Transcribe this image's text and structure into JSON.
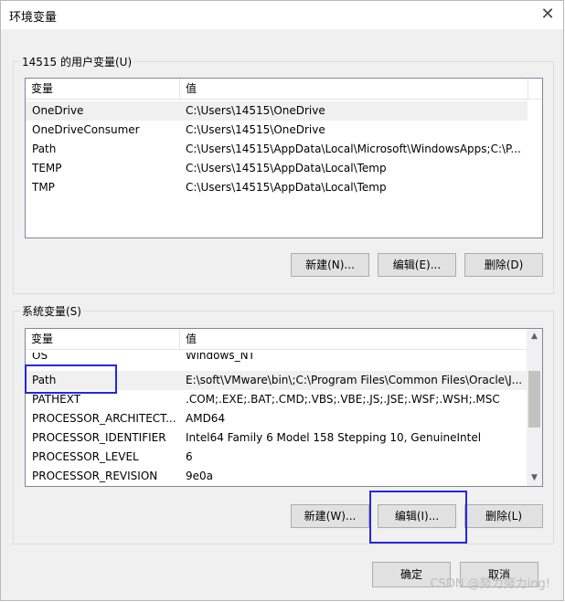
{
  "window": {
    "title": "环境变量",
    "close_glyph": "✕"
  },
  "user_vars": {
    "group_title": "14515 的用户变量(U)",
    "headers": [
      "变量",
      "值"
    ],
    "rows": [
      {
        "name": "OneDrive",
        "value": "C:\\Users\\14515\\OneDrive"
      },
      {
        "name": "OneDriveConsumer",
        "value": "C:\\Users\\14515\\OneDrive"
      },
      {
        "name": "Path",
        "value": "C:\\Users\\14515\\AppData\\Local\\Microsoft\\WindowsApps;C:\\P..."
      },
      {
        "name": "TEMP",
        "value": "C:\\Users\\14515\\AppData\\Local\\Temp"
      },
      {
        "name": "TMP",
        "value": "C:\\Users\\14515\\AppData\\Local\\Temp"
      }
    ],
    "buttons": {
      "new": "新建(N)...",
      "edit": "编辑(E)...",
      "delete": "删除(D)"
    }
  },
  "sys_vars": {
    "group_title": "系统变量(S)",
    "headers": [
      "变量",
      "值"
    ],
    "rows": [
      {
        "name": "OS",
        "value": "Windows_NT"
      },
      {
        "name": "Path",
        "value": "E:\\soft\\VMware\\bin\\;C:\\Program Files\\Common Files\\Oracle\\J..."
      },
      {
        "name": "PATHEXT",
        "value": ".COM;.EXE;.BAT;.CMD;.VBS;.VBE;.JS;.JSE;.WSF;.WSH;.MSC"
      },
      {
        "name": "PROCESSOR_ARCHITECT...",
        "value": "AMD64"
      },
      {
        "name": "PROCESSOR_IDENTIFIER",
        "value": "Intel64 Family 6 Model 158 Stepping 10, GenuineIntel"
      },
      {
        "name": "PROCESSOR_LEVEL",
        "value": "6"
      },
      {
        "name": "PROCESSOR_REVISION",
        "value": "9e0a"
      }
    ],
    "buttons": {
      "new": "新建(W)...",
      "edit": "编辑(I)...",
      "delete": "删除(L)"
    }
  },
  "footer": {
    "ok": "确定",
    "cancel": "取消"
  },
  "watermark": "CSDN @努力努力ing!",
  "colors": {
    "highlight": "#2626e6",
    "selection": "#e5f3ff"
  }
}
